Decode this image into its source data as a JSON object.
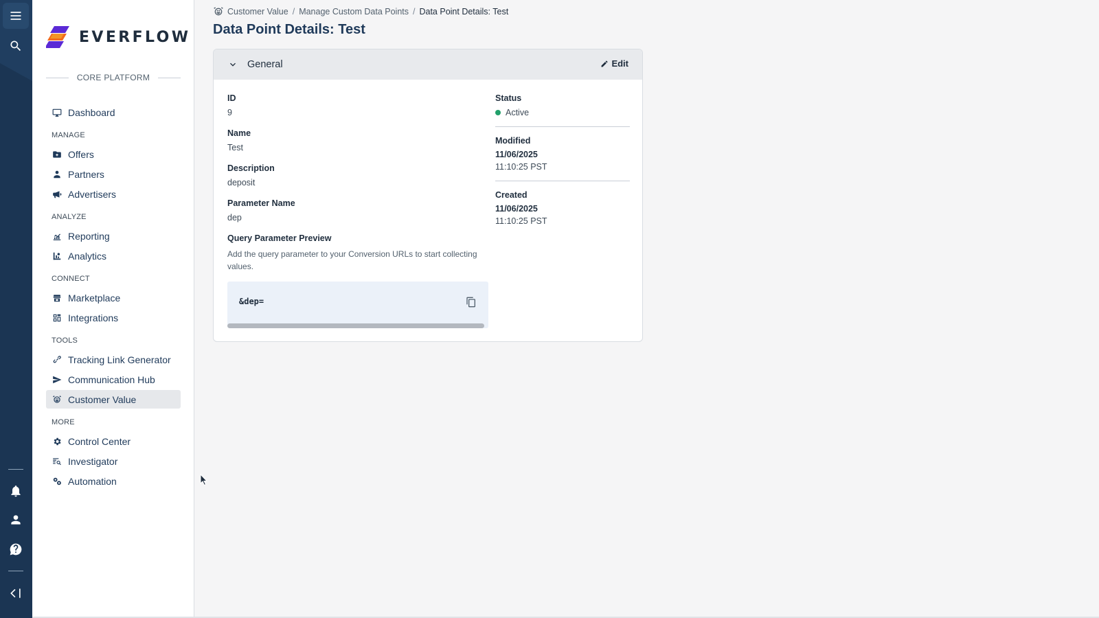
{
  "rail": {
    "icons": [
      "menu-icon",
      "search-icon",
      "bell-icon",
      "user-icon",
      "help-icon",
      "collapse-icon"
    ]
  },
  "brand": {
    "name": "EVERFLOW",
    "platform": "CORE PLATFORM",
    "colors": {
      "purple": "#5b2ad6",
      "orange": "#f26b1d",
      "yellow": "#f5b82e"
    }
  },
  "sidebar": {
    "dashboard": "Dashboard",
    "sections": {
      "manage": "MANAGE",
      "analyze": "ANALYZE",
      "connect": "CONNECT",
      "tools": "TOOLS",
      "more": "MORE"
    },
    "manage": [
      "Offers",
      "Partners",
      "Advertisers"
    ],
    "analyze": [
      "Reporting",
      "Analytics"
    ],
    "connect": [
      "Marketplace",
      "Integrations"
    ],
    "tools": [
      "Tracking Link Generator",
      "Communication Hub",
      "Customer Value"
    ],
    "more": [
      "Control Center",
      "Investigator",
      "Automation"
    ],
    "active": "Customer Value"
  },
  "breadcrumb": {
    "items": [
      "Customer Value",
      "Manage Custom Data Points",
      "Data Point Details: Test"
    ],
    "separator": "/"
  },
  "page": {
    "title": "Data Point Details: Test"
  },
  "card": {
    "title": "General",
    "edit_label": "Edit",
    "id_label": "ID",
    "id_value": "9",
    "name_label": "Name",
    "name_value": "Test",
    "description_label": "Description",
    "description_value": "deposit",
    "param_label": "Parameter Name",
    "param_value": "dep",
    "preview_label": "Query Parameter Preview",
    "preview_help": "Add the query parameter to your Conversion URLs to start collecting values.",
    "preview_code": "&dep=",
    "status_label": "Status",
    "status_value": "Active",
    "status_color": "#22a06b",
    "modified_label": "Modified",
    "modified_date": "11/06/2025",
    "modified_time": "11:10:25 PST",
    "created_label": "Created",
    "created_date": "11/06/2025",
    "created_time": "11:10:25 PST"
  }
}
